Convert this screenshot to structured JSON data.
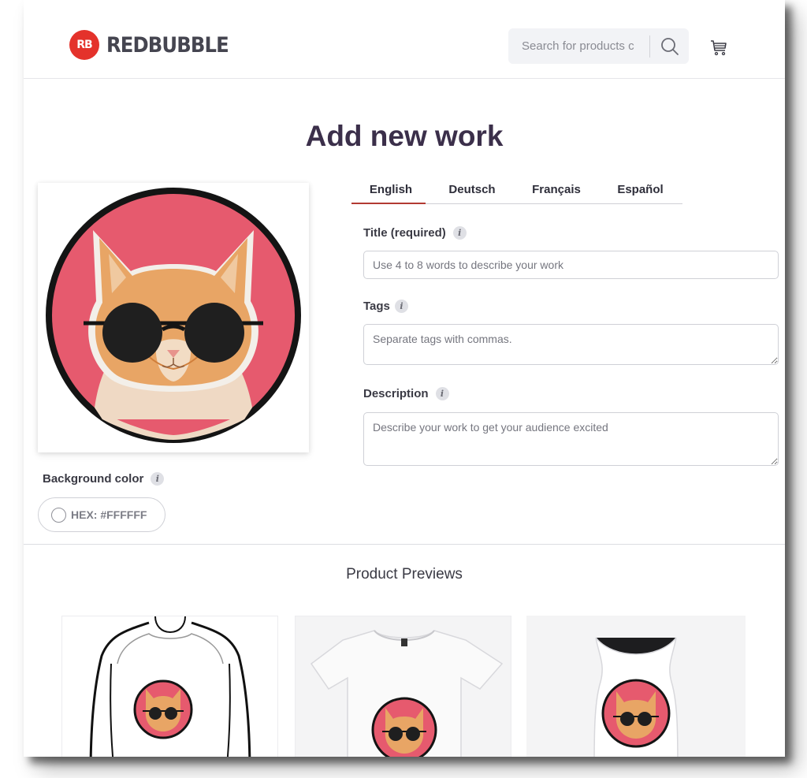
{
  "header": {
    "logo_mark": "RB",
    "logo_text": "REDBUBBLE",
    "search_placeholder": "Search for products c"
  },
  "page_title": "Add new work",
  "language_tabs": [
    {
      "label": "English",
      "active": true
    },
    {
      "label": "Deutsch",
      "active": false
    },
    {
      "label": "Français",
      "active": false
    },
    {
      "label": "Español",
      "active": false
    }
  ],
  "form": {
    "title_label": "Title (required)",
    "title_placeholder": "Use 4 to 8 words to describe your work",
    "tags_label": "Tags",
    "tags_placeholder": "Separate tags with commas.",
    "description_label": "Description",
    "description_placeholder": "Describe your work to get your audience excited"
  },
  "background_color": {
    "label": "Background color",
    "value": "HEX: #FFFFFF"
  },
  "previews": {
    "title": "Product Previews",
    "items": [
      "classic-tee-on-model",
      "white-tshirt",
      "white-tank-top"
    ]
  },
  "colors": {
    "brand_red": "#e4322b",
    "artwork_pink": "#e65a6e",
    "tab_underline": "#b23a32"
  },
  "icons": [
    "search-icon",
    "cart-icon",
    "info-icon"
  ]
}
